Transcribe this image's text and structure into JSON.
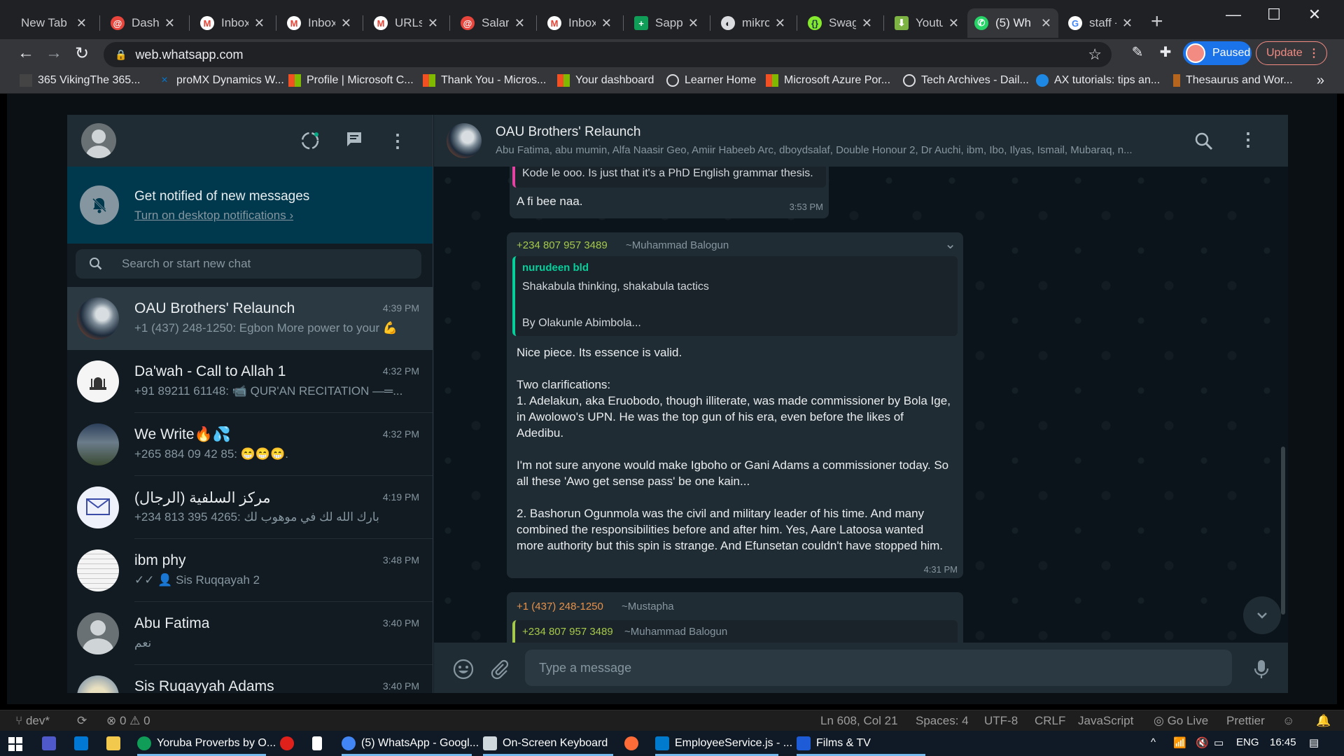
{
  "browser": {
    "tabs": [
      {
        "label": "New Tab",
        "icon": "none"
      },
      {
        "label": "Dashb",
        "icon": "spiral-icon",
        "color": "#e8453c"
      },
      {
        "label": "Inbox",
        "icon": "gmail-icon",
        "color": "#ea4335"
      },
      {
        "label": "Inbox",
        "icon": "gmail-icon",
        "color": "#ea4335"
      },
      {
        "label": "URLs",
        "icon": "gmail-icon",
        "color": "#ea4335"
      },
      {
        "label": "Salary",
        "icon": "spiral-icon",
        "color": "#e8453c"
      },
      {
        "label": "Inbox",
        "icon": "gmail-icon",
        "color": "#ea4335"
      },
      {
        "label": "Sapph",
        "icon": "sheets-icon",
        "color": "#0f9d58"
      },
      {
        "label": "mikrot",
        "icon": "mikrotik-icon",
        "color": "#dadce0"
      },
      {
        "label": "Swagg",
        "icon": "swagger-icon",
        "color": "#85ea2d"
      },
      {
        "label": "Youtul",
        "icon": "download-icon",
        "color": "#7cb342"
      },
      {
        "label": "(5) Wh",
        "icon": "whatsapp-icon",
        "color": "#25d366"
      },
      {
        "label": "staff -",
        "icon": "google-icon",
        "color": "#4285f4"
      }
    ],
    "url": "web.whatsapp.com",
    "profile_label": "Paused",
    "update_label": "Update",
    "bookmarks": [
      {
        "label": "365 VikingThe 365...",
        "color": "#444"
      },
      {
        "label": "proMX Dynamics W...",
        "color": "#0078d4"
      },
      {
        "label": "Profile | Microsoft C...",
        "color": "#f25022"
      },
      {
        "label": "Thank You - Micros...",
        "color": "#f25022"
      },
      {
        "label": "Your dashboard",
        "color": "#f25022"
      },
      {
        "label": "Learner Home",
        "color": "#dadce0"
      },
      {
        "label": "Microsoft Azure Por...",
        "color": "#f25022"
      },
      {
        "label": "Tech Archives - Dail...",
        "color": "#dadce0"
      },
      {
        "label": "AX tutorials: tips an...",
        "color": "#1e88e5"
      },
      {
        "label": "Thesaurus and Wor...",
        "color": "#b5651d"
      }
    ],
    "bookmarks_more": "»"
  },
  "whatsapp": {
    "notification": {
      "title": "Get notified of new messages",
      "link": "Turn on desktop notifications ›"
    },
    "search_placeholder": "Search or start new chat",
    "chats": [
      {
        "name": "OAU Brothers' Relaunch",
        "time": "4:39 PM",
        "message": "+1 (437) 248-1250: Egbon More power to your 💪",
        "selected": true,
        "avatar_color": "#4a5a70"
      },
      {
        "name": "Da'wah - Call to Allah 1",
        "time": "4:32 PM",
        "message": "+91 89211 61148: 📹 QUR'AN RECITATION —═...",
        "selected": false,
        "avatar_color": "#f0f0f0"
      },
      {
        "name": "We Write🔥💦",
        "time": "4:32 PM",
        "message": "+265 884 09 42 85: 😁😁😁.",
        "selected": false,
        "avatar_color": "#3b5a7a"
      },
      {
        "name": "مركز السلفية (الرجال)",
        "time": "4:19 PM",
        "message": "+234 813 395 4265: بارك الله لك في موهوب لك",
        "selected": false,
        "avatar_color": "#e8e8f8"
      },
      {
        "name": "ibm phy",
        "time": "3:48 PM",
        "message": "✓✓ 👤 Sis Ruqqayah 2",
        "selected": false,
        "avatar_color": "#f2f2f2"
      },
      {
        "name": "Abu Fatima",
        "time": "3:40 PM",
        "message": "نعم",
        "selected": false,
        "avatar_color": "#6a7175"
      },
      {
        "name": "Sis Ruqayyah Adams",
        "time": "3:40 PM",
        "message": "",
        "selected": false,
        "avatar_color": "#c9b98a"
      }
    ],
    "conversation": {
      "title": "OAU Brothers' Relaunch",
      "members": "Abu Fatima, abu mumin, Alfa Naasir Geo, Amiir Habeeb Arc, dboydsalaf, Double Honour 2, Dr Auchi, ibm, Ibo, Ilyas, Ismail, Mubaraq, n...",
      "msg1": {
        "quote_text": "Kode le ooo. Is just that it's a PhD English grammar thesis.",
        "text": "A fi bee naa.",
        "time": "3:53 PM"
      },
      "msg2": {
        "sender_phone": "+234 807 957 3489",
        "sender_name": "~Muhammad Balogun",
        "quote_author": "nurudeen bld",
        "quote_line1": "Shakabula thinking, shakabula tactics",
        "quote_line2": "By Olakunle Abimbola...",
        "text": "Nice piece. Its essence is valid.\n\nTwo clarifications:\n1. Adelakun, aka Eruobodo, though illiterate, was made commissioner by Bola Ige, in Awolowo's UPN. He was the top gun of his era, even before the likes of Adedibu.\n\nI'm not sure anyone would make Igboho or Gani Adams a commissioner today. So all these 'Awo get sense pass' be one kain...\n\n2. Bashorun Ogunmola was the civil and military leader of his time. And many combined the responsibilities before and after him. Yes, Aare Latoosa wanted more authority but this spin is strange. And Efunsetan couldn't have stopped him.",
        "time": "4:31 PM"
      },
      "msg3": {
        "sender_phone": "+1 (437) 248-1250",
        "sender_name": "~Mustapha",
        "quote_phone": "+234 807 957 3489",
        "quote_name": "~Muhammad Balogun"
      }
    },
    "composer_placeholder": "Type a message"
  },
  "statusbar": {
    "branch": "dev*",
    "problems": "⊗ 0 ⚠ 0",
    "position": "Ln 608, Col 21",
    "spaces": "Spaces: 4",
    "encoding": "UTF-8",
    "eol": "CRLF",
    "language": "JavaScript",
    "golive": "Go Live",
    "prettier": "Prettier"
  },
  "taskbar": {
    "items": [
      {
        "label": "Yoruba Proverbs by O...",
        "color": "#0f9d58"
      },
      {
        "label": "(5) WhatsApp - Googl...",
        "color": "#4285f4"
      },
      {
        "label": "On-Screen Keyboard",
        "color": "#cfd8dc"
      },
      {
        "label": "EmployeeService.js - ...",
        "color": "#007acc"
      },
      {
        "label": "Films & TV",
        "color": "#1e5bd6"
      }
    ],
    "lang": "ENG",
    "time": "16:45"
  },
  "colors": {
    "whatsapp_bg": "#111b21",
    "header": "#202c33",
    "notify_banner": "#00394d",
    "phone_green": "#a5c94a",
    "phone_orange": "#e7924b",
    "quote_author_green": "#06cf9c"
  }
}
